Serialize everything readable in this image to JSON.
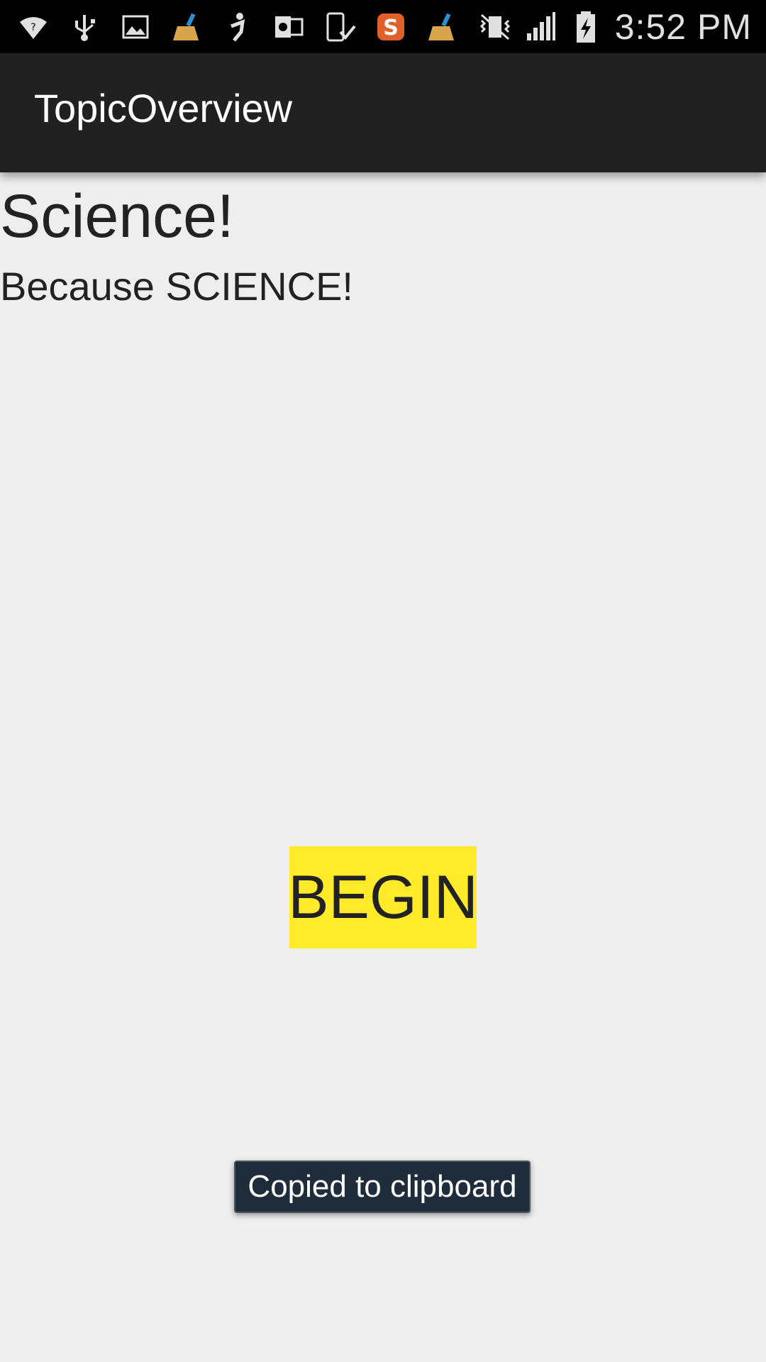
{
  "status_bar": {
    "time": "3:52 PM",
    "left_icons": [
      "wifi-question-icon",
      "usb-icon",
      "image-icon",
      "broom-icon",
      "person-icon",
      "outlook-icon",
      "device-check-icon",
      "s-app-icon",
      "broom-icon"
    ],
    "right_icons": [
      "vibrate-mute-icon",
      "signal-icon",
      "battery-charging-icon"
    ]
  },
  "app_bar": {
    "title": "TopicOverview"
  },
  "content": {
    "topic_title": "Science!",
    "topic_subtitle": "Because SCIENCE!",
    "begin_label": "BEGIN"
  },
  "toast": {
    "message": "Copied to clipboard"
  },
  "colors": {
    "status_bar_bg": "#000000",
    "app_bar_bg": "#212121",
    "background": "#eeeeee",
    "begin_button_bg": "#ffeb29",
    "toast_bg": "#1f2d3b"
  }
}
